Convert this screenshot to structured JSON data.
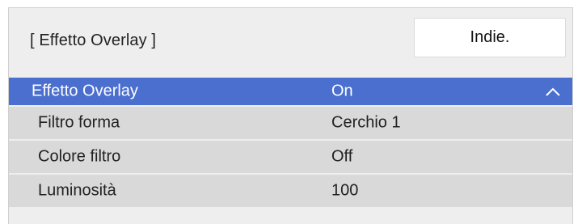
{
  "header": {
    "title": "[ Effetto Overlay ]",
    "back_label": "Indie."
  },
  "menu": {
    "rows": [
      {
        "label": "Effetto Overlay",
        "value": "On",
        "selected": true,
        "icon": "chevron-up-icon"
      },
      {
        "label": "Filtro forma",
        "value": "Cerchio 1"
      },
      {
        "label": "Colore filtro",
        "value": "Off"
      },
      {
        "label": "Luminosità",
        "value": "100"
      }
    ]
  },
  "colors": {
    "selected_bg": "#4b6fcf",
    "row_bg": "#d9d9d9",
    "panel_bg": "#eeeeee"
  }
}
